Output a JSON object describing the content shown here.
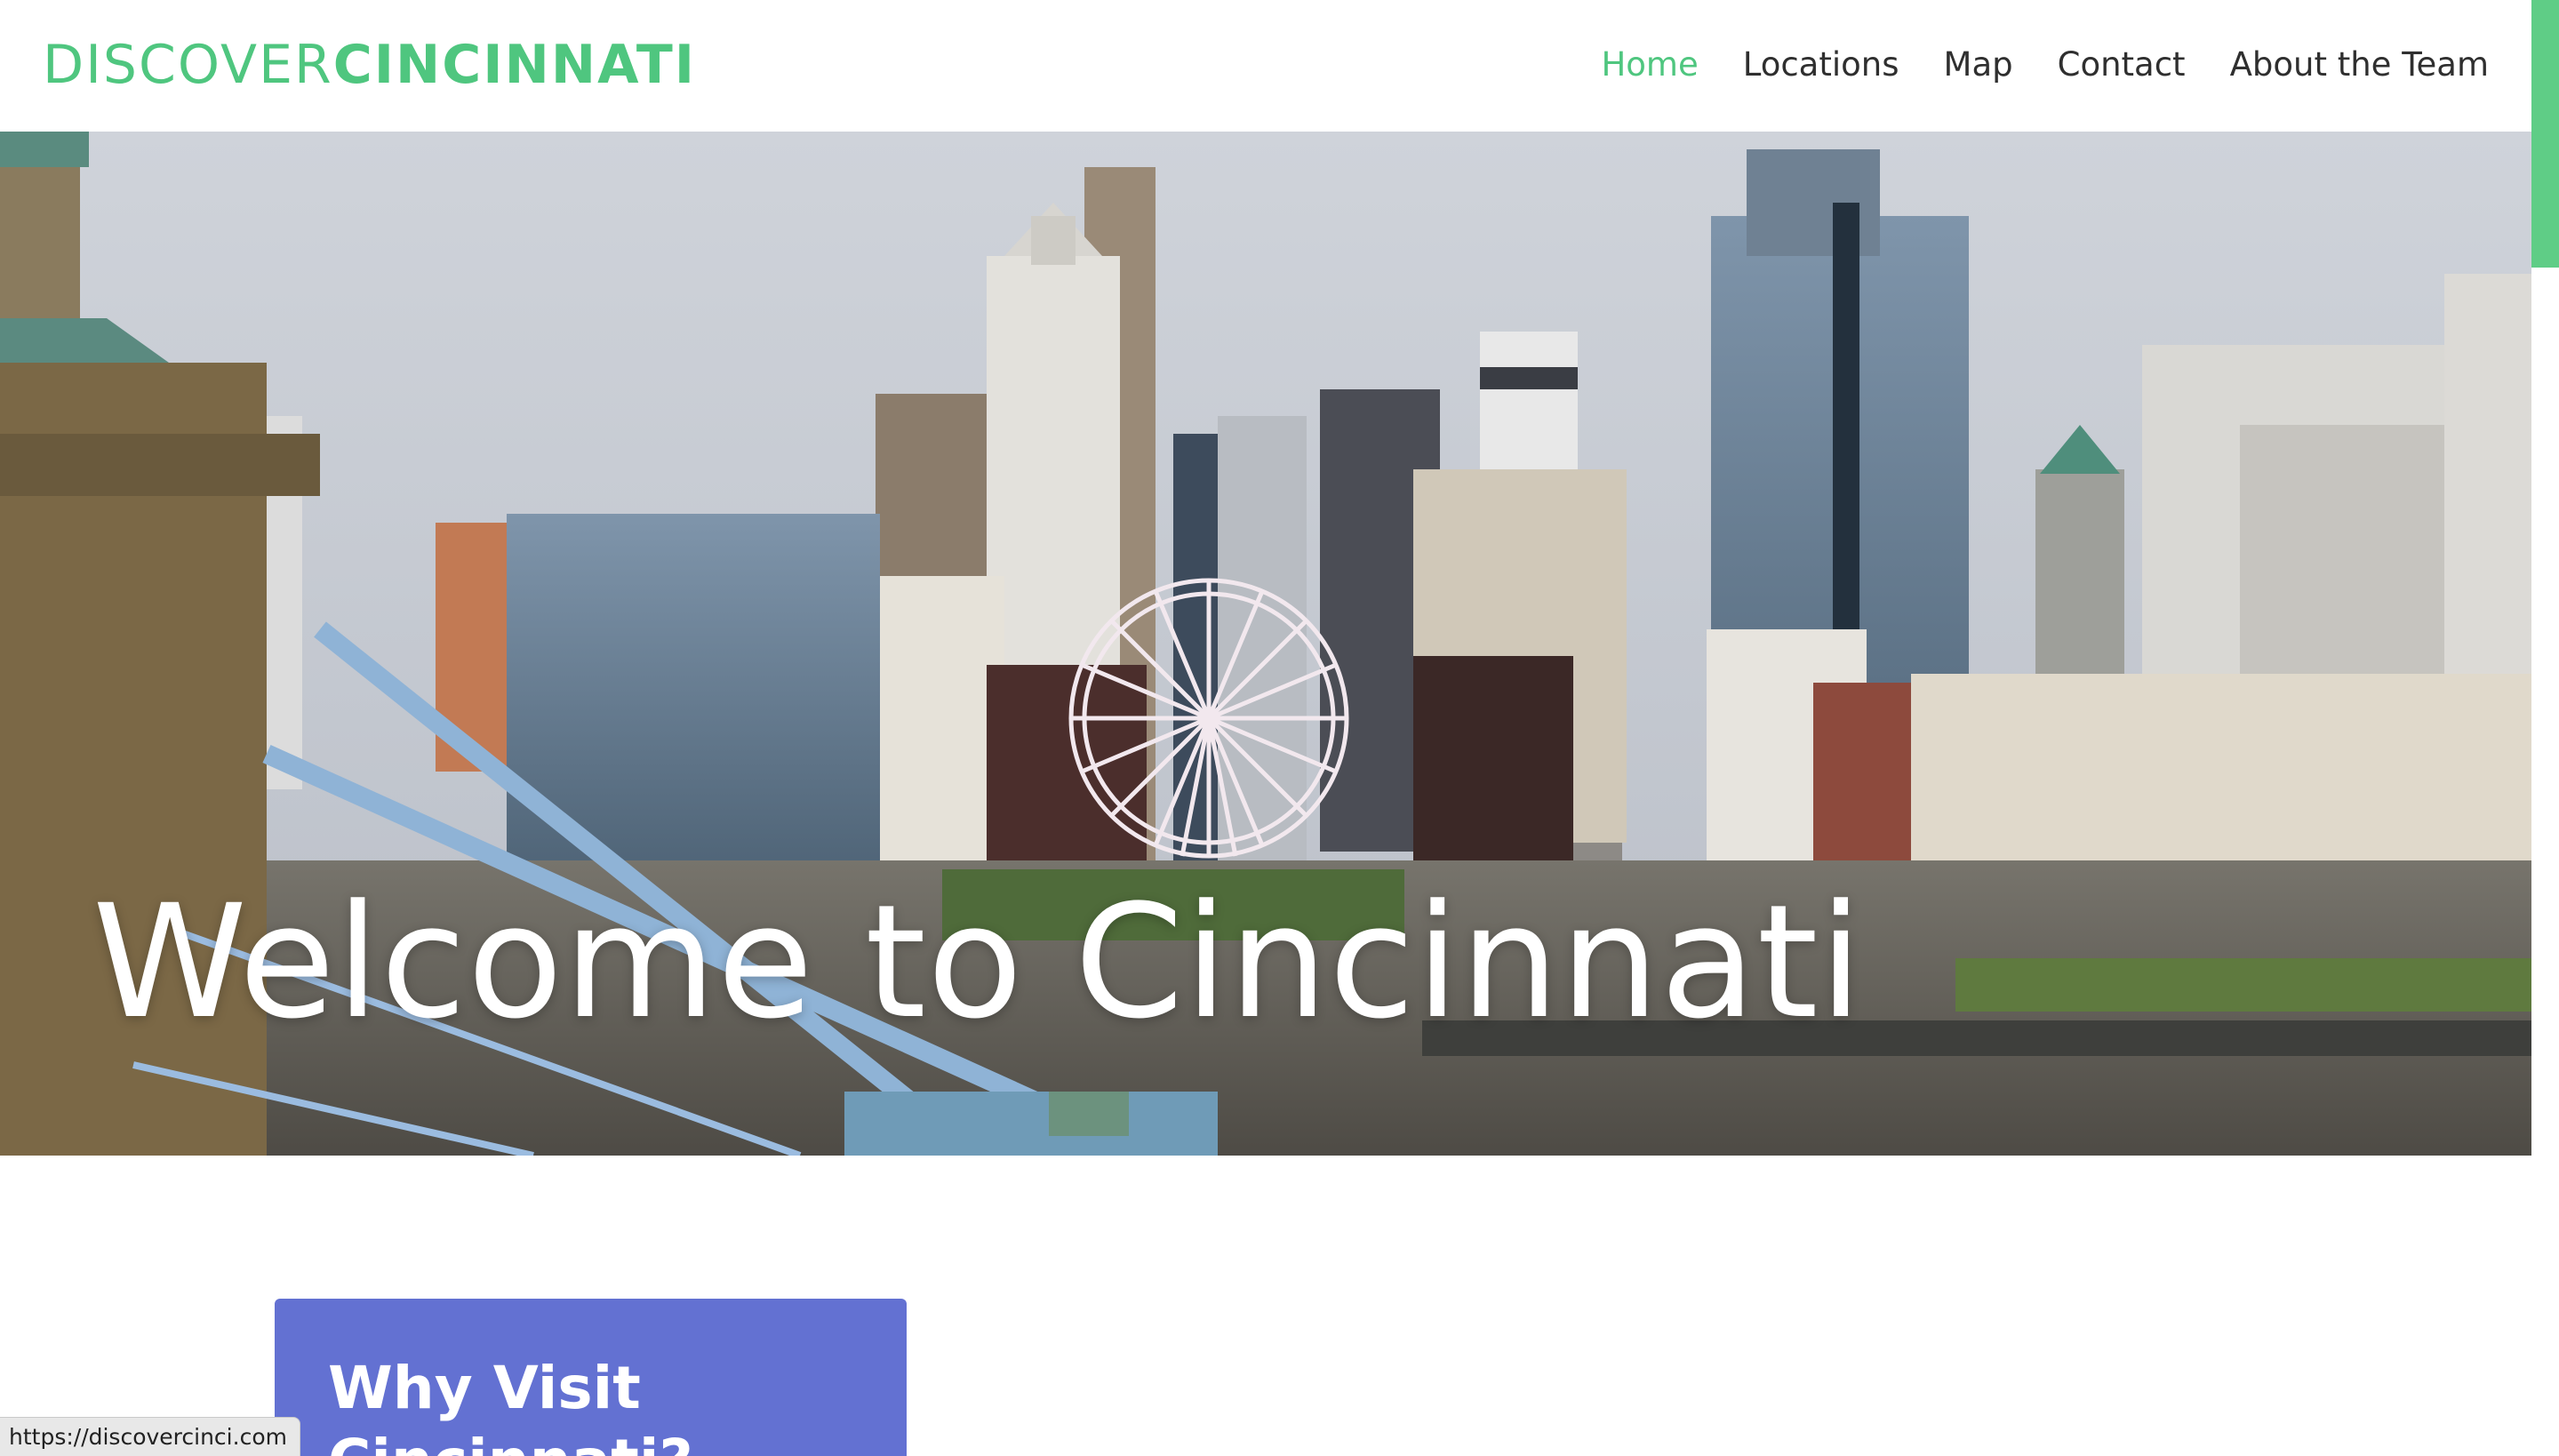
{
  "site": {
    "logo_light": "DISCOVER",
    "logo_bold": "CINCINNATI"
  },
  "nav": {
    "items": [
      {
        "label": "Home",
        "active": true
      },
      {
        "label": "Locations",
        "active": false
      },
      {
        "label": "Map",
        "active": false
      },
      {
        "label": "Contact",
        "active": false
      },
      {
        "label": "About the Team",
        "active": false
      }
    ]
  },
  "hero": {
    "title": "Welcome to Cincinnati",
    "image_icon": "city-skyline-image"
  },
  "card": {
    "title": "Why Visit Cincinnati?"
  },
  "status_bar": {
    "url": "https://discovercinci.com"
  },
  "colors": {
    "accent": "#4fc67f",
    "card": "#6371d2",
    "nav_text": "#2f2f2f",
    "scrollbar_thumb": "#5fcd86"
  }
}
